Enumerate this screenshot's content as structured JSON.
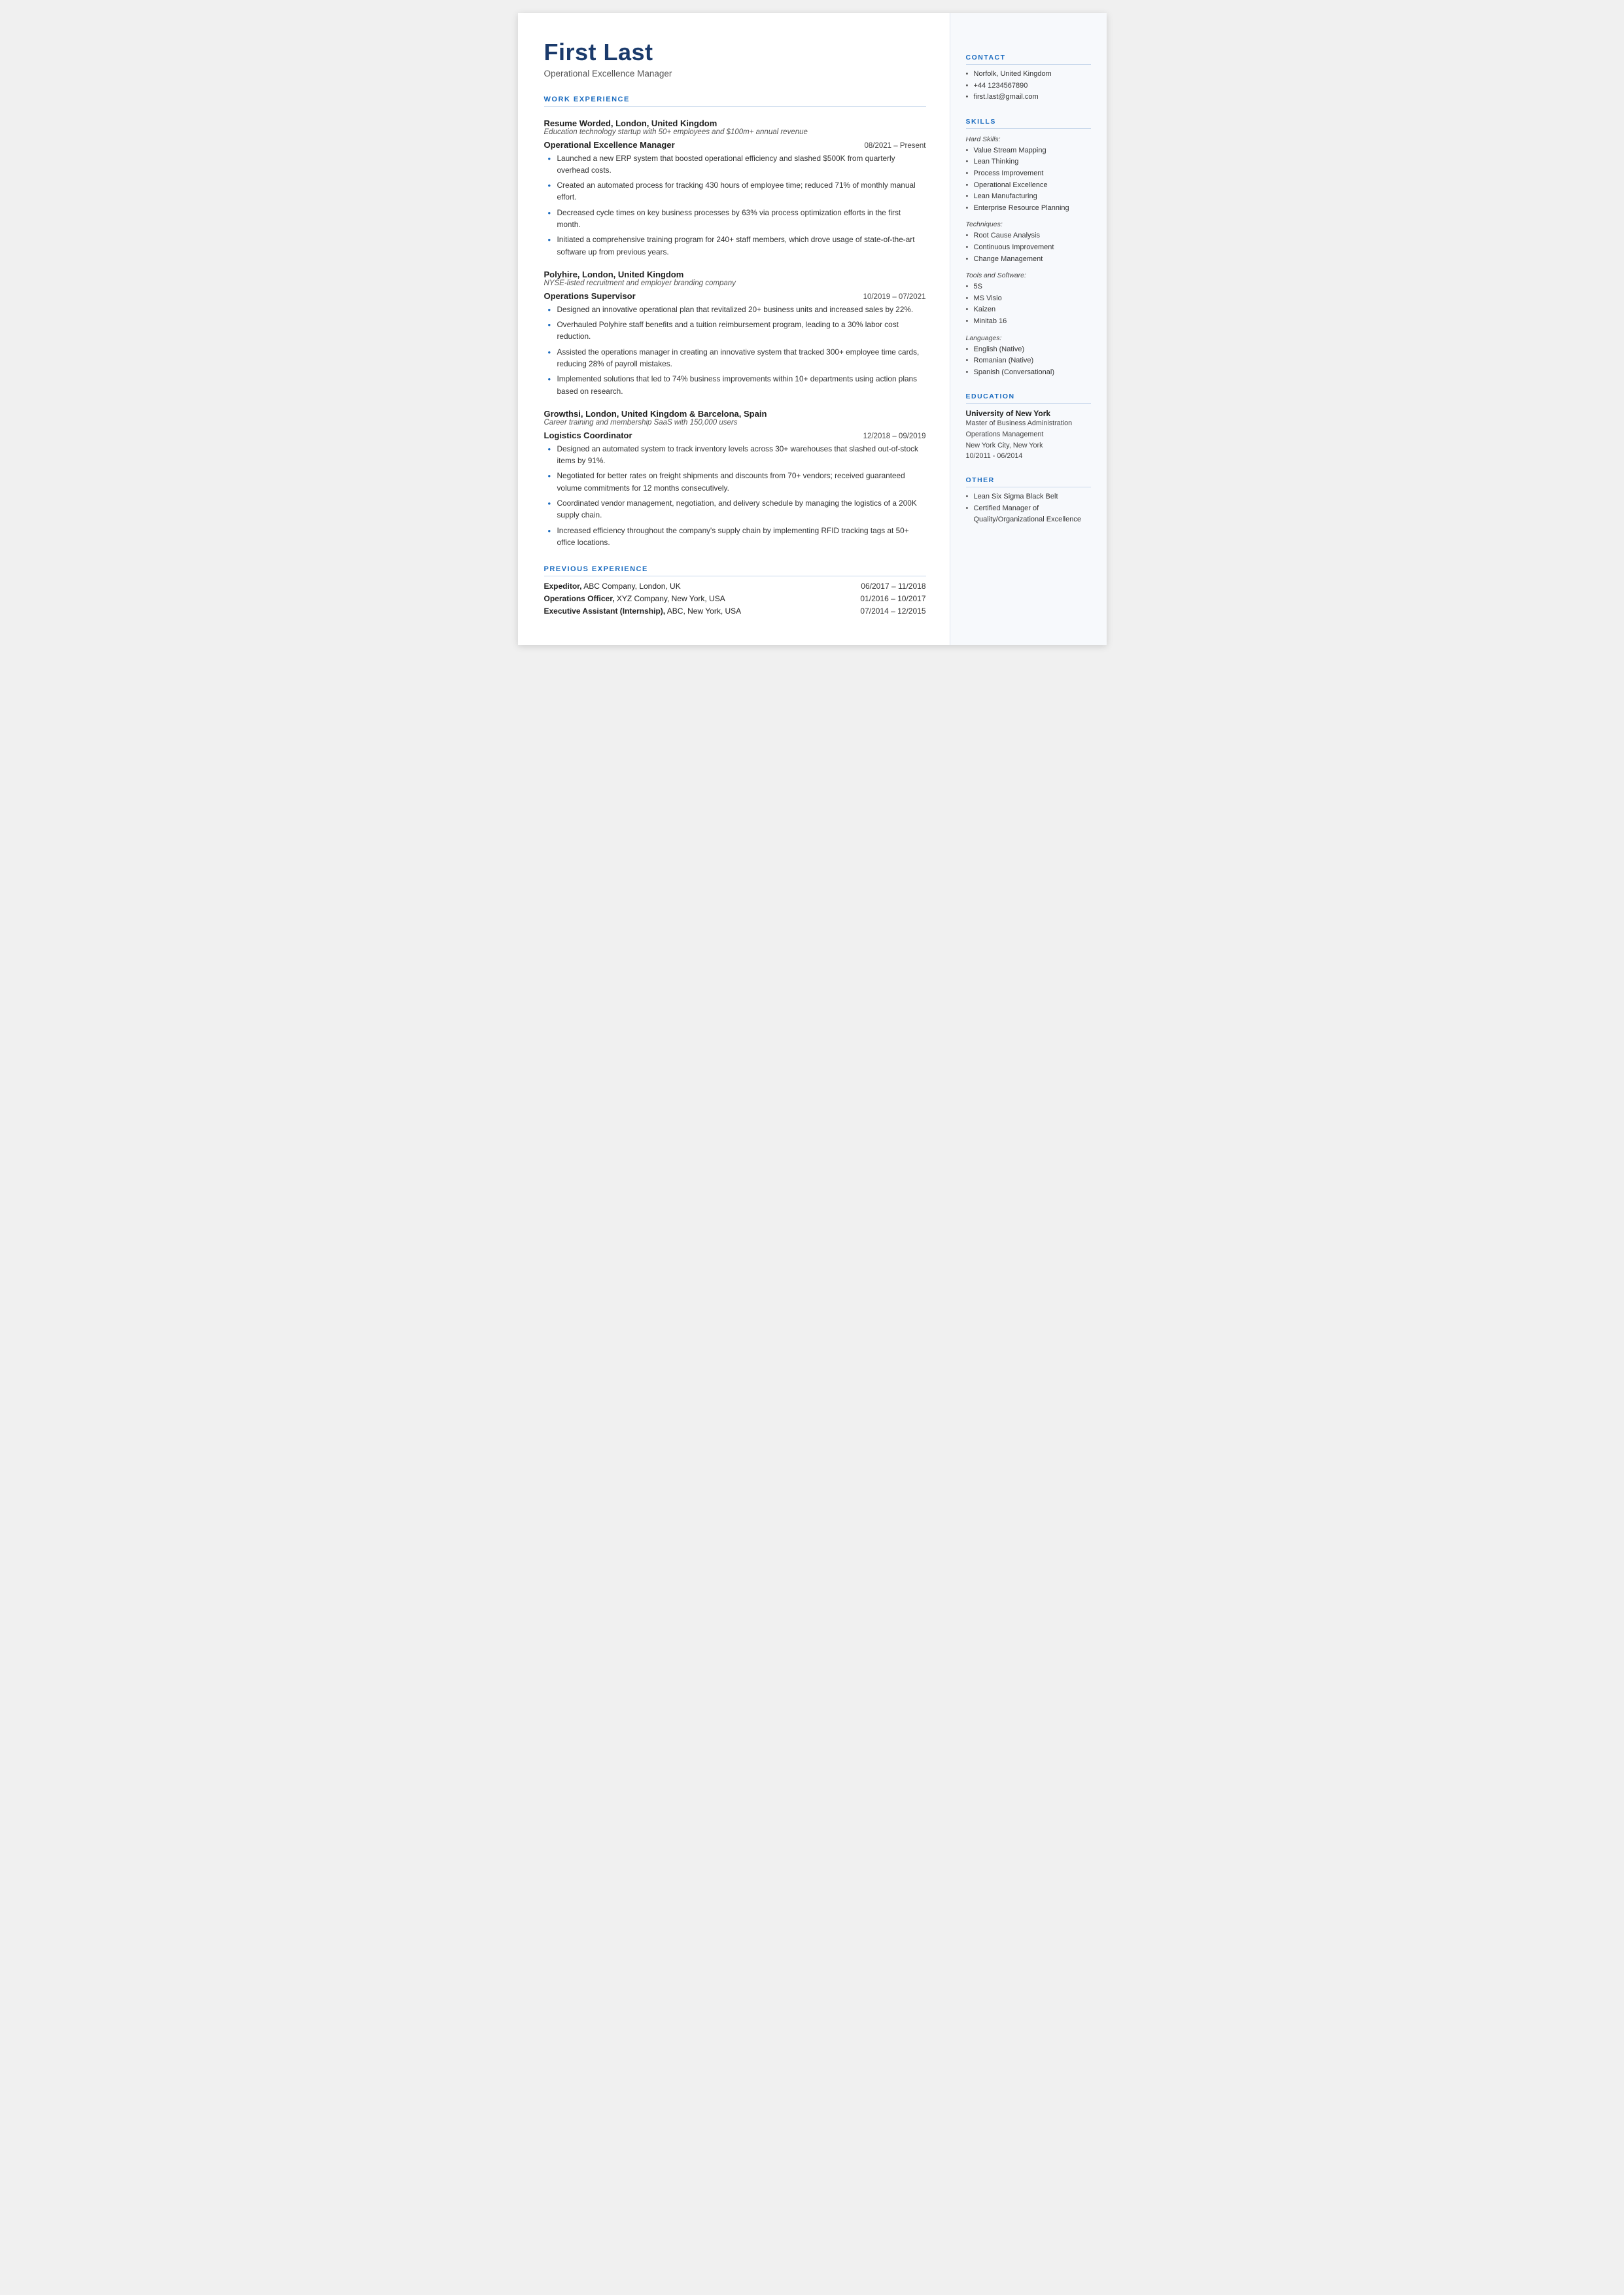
{
  "header": {
    "name": "First Last",
    "job_title": "Operational Excellence Manager"
  },
  "sections": {
    "work_experience_label": "WORK EXPERIENCE",
    "previous_experience_label": "PREVIOUS EXPERIENCE"
  },
  "jobs": [
    {
      "company": "Resume Worded,",
      "company_rest": " London, United Kingdom",
      "description": "Education technology startup with 50+ employees and $100m+ annual revenue",
      "role": "Operational Excellence Manager",
      "date": "08/2021 – Present",
      "bullets": [
        "Launched a new ERP system that boosted operational efficiency and slashed $500K from quarterly overhead costs.",
        "Created an automated process for tracking 430 hours of employee time; reduced 71% of monthly manual effort.",
        "Decreased cycle times on key business processes by 63% via process optimization efforts in the first month.",
        "Initiated a comprehensive training program for 240+ staff members, which drove usage of state-of-the-art software up from previous years."
      ]
    },
    {
      "company": "Polyhire,",
      "company_rest": " London, United Kingdom",
      "description": "NYSE-listed recruitment and employer branding company",
      "role": "Operations Supervisor",
      "date": "10/2019 – 07/2021",
      "bullets": [
        "Designed an innovative operational plan that revitalized 20+ business units and increased sales by 22%.",
        "Overhauled Polyhire staff benefits and a tuition reimbursement program, leading to a 30% labor cost reduction.",
        "Assisted the operations manager in creating an innovative system that tracked 300+ employee time cards, reducing 28% of payroll mistakes.",
        "Implemented solutions that led to 74% business improvements within 10+ departments using action plans based on research."
      ]
    },
    {
      "company": "Growthsi,",
      "company_rest": " London, United Kingdom & Barcelona, Spain",
      "description": "Career training and membership SaaS with 150,000 users",
      "role": "Logistics Coordinator",
      "date": "12/2018 – 09/2019",
      "bullets": [
        "Designed an automated system to track inventory levels across 30+ warehouses that slashed out-of-stock items by 91%.",
        "Negotiated for better rates on freight shipments and discounts from 70+ vendors; received guaranteed volume commitments for 12 months consecutively.",
        "Coordinated vendor management, negotiation, and delivery schedule by managing the logistics of a 200K supply chain.",
        "Increased efficiency throughout the company's supply chain by implementing RFID tracking tags at 50+ office locations."
      ]
    }
  ],
  "previous_experience": [
    {
      "left": "Expeditor, ABC Company, London, UK",
      "left_bold": "Expeditor,",
      "date": "06/2017 – 11/2018"
    },
    {
      "left": "Operations Officer, XYZ Company, New York, USA",
      "left_bold": "Operations Officer,",
      "date": "01/2016 – 10/2017"
    },
    {
      "left": "Executive Assistant (Internship), ABC, New York, USA",
      "left_bold": "Executive Assistant (Internship),",
      "date": "07/2014 – 12/2015"
    }
  ],
  "sidebar": {
    "contact_label": "CONTACT",
    "contact_items": [
      "Norfolk, United Kingdom",
      "+44 1234567890",
      "first.last@gmail.com"
    ],
    "skills_label": "SKILLS",
    "hard_skills_label": "Hard Skills:",
    "hard_skills": [
      "Value Stream Mapping",
      "Lean Thinking",
      "Process Improvement",
      "Operational Excellence",
      "Lean Manufacturing",
      "Enterprise Resource Planning"
    ],
    "techniques_label": "Techniques:",
    "techniques": [
      "Root Cause Analysis",
      "Continuous Improvement",
      "Change Management"
    ],
    "tools_label": "Tools and Software:",
    "tools": [
      "5S",
      "MS Visio",
      "Kaizen",
      "Minitab 16"
    ],
    "languages_label": "Languages:",
    "languages": [
      "English (Native)",
      "Romanian (Native)",
      "Spanish (Conversational)"
    ],
    "education_label": "EDUCATION",
    "education": {
      "school": "University of New York",
      "degree": "Master of Business Administration",
      "field": "Operations Management",
      "location": "New York City, New York",
      "dates": "10/2011 - 06/2014"
    },
    "other_label": "OTHER",
    "other_items": [
      "Lean Six Sigma Black Belt",
      "Certified Manager of Quality/Organizational Excellence"
    ]
  }
}
